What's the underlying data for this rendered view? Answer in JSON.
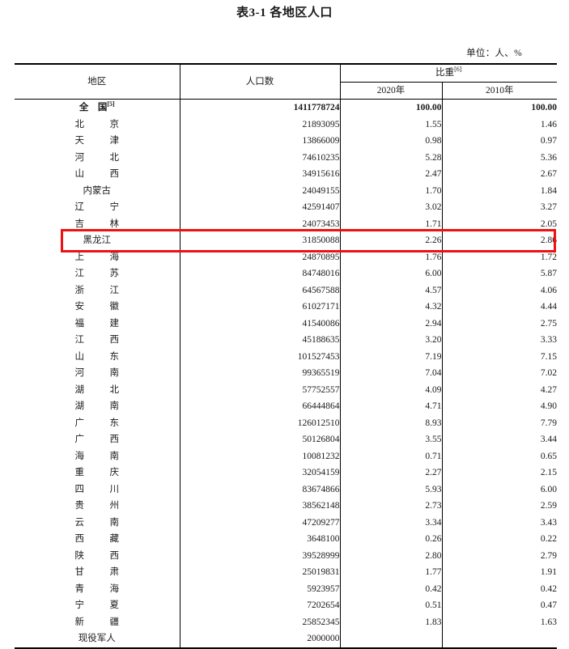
{
  "title": "表3-1 各地区人口",
  "unit_note": "单位：人、%",
  "header": {
    "region": "地区",
    "population": "人口数",
    "share": "比重",
    "share_footnote": "[6]",
    "year_2020": "2020年",
    "year_2010": "2010年"
  },
  "highlight": {
    "region": "黑龙江",
    "color": "#ee1111"
  },
  "rows": [
    {
      "region": "全　国",
      "footnote": "[5]",
      "population": "1411778724",
      "pct2020": "100.00",
      "pct2010": "100.00",
      "bold": true,
      "spaced": false
    },
    {
      "region": "北　京",
      "footnote": "",
      "population": "21893095",
      "pct2020": "1.55",
      "pct2010": "1.46",
      "bold": false,
      "spaced": true
    },
    {
      "region": "天　津",
      "footnote": "",
      "population": "13866009",
      "pct2020": "0.98",
      "pct2010": "0.97",
      "bold": false,
      "spaced": true
    },
    {
      "region": "河　北",
      "footnote": "",
      "population": "74610235",
      "pct2020": "5.28",
      "pct2010": "5.36",
      "bold": false,
      "spaced": true
    },
    {
      "region": "山　西",
      "footnote": "",
      "population": "34915616",
      "pct2020": "2.47",
      "pct2010": "2.67",
      "bold": false,
      "spaced": true
    },
    {
      "region": "内蒙古",
      "footnote": "",
      "population": "24049155",
      "pct2020": "1.70",
      "pct2010": "1.84",
      "bold": false,
      "spaced": false
    },
    {
      "region": "辽　宁",
      "footnote": "",
      "population": "42591407",
      "pct2020": "3.02",
      "pct2010": "3.27",
      "bold": false,
      "spaced": true
    },
    {
      "region": "吉　林",
      "footnote": "",
      "population": "24073453",
      "pct2020": "1.71",
      "pct2010": "2.05",
      "bold": false,
      "spaced": true
    },
    {
      "region": "黑龙江",
      "footnote": "",
      "population": "31850088",
      "pct2020": "2.26",
      "pct2010": "2.86",
      "bold": false,
      "spaced": false
    },
    {
      "region": "上　海",
      "footnote": "",
      "population": "24870895",
      "pct2020": "1.76",
      "pct2010": "1.72",
      "bold": false,
      "spaced": true
    },
    {
      "region": "江　苏",
      "footnote": "",
      "population": "84748016",
      "pct2020": "6.00",
      "pct2010": "5.87",
      "bold": false,
      "spaced": true
    },
    {
      "region": "浙　江",
      "footnote": "",
      "population": "64567588",
      "pct2020": "4.57",
      "pct2010": "4.06",
      "bold": false,
      "spaced": true
    },
    {
      "region": "安　徽",
      "footnote": "",
      "population": "61027171",
      "pct2020": "4.32",
      "pct2010": "4.44",
      "bold": false,
      "spaced": true
    },
    {
      "region": "福　建",
      "footnote": "",
      "population": "41540086",
      "pct2020": "2.94",
      "pct2010": "2.75",
      "bold": false,
      "spaced": true
    },
    {
      "region": "江　西",
      "footnote": "",
      "population": "45188635",
      "pct2020": "3.20",
      "pct2010": "3.33",
      "bold": false,
      "spaced": true
    },
    {
      "region": "山　东",
      "footnote": "",
      "population": "101527453",
      "pct2020": "7.19",
      "pct2010": "7.15",
      "bold": false,
      "spaced": true
    },
    {
      "region": "河　南",
      "footnote": "",
      "population": "99365519",
      "pct2020": "7.04",
      "pct2010": "7.02",
      "bold": false,
      "spaced": true
    },
    {
      "region": "湖　北",
      "footnote": "",
      "population": "57752557",
      "pct2020": "4.09",
      "pct2010": "4.27",
      "bold": false,
      "spaced": true
    },
    {
      "region": "湖　南",
      "footnote": "",
      "population": "66444864",
      "pct2020": "4.71",
      "pct2010": "4.90",
      "bold": false,
      "spaced": true
    },
    {
      "region": "广　东",
      "footnote": "",
      "population": "126012510",
      "pct2020": "8.93",
      "pct2010": "7.79",
      "bold": false,
      "spaced": true
    },
    {
      "region": "广　西",
      "footnote": "",
      "population": "50126804",
      "pct2020": "3.55",
      "pct2010": "3.44",
      "bold": false,
      "spaced": true
    },
    {
      "region": "海　南",
      "footnote": "",
      "population": "10081232",
      "pct2020": "0.71",
      "pct2010": "0.65",
      "bold": false,
      "spaced": true
    },
    {
      "region": "重　庆",
      "footnote": "",
      "population": "32054159",
      "pct2020": "2.27",
      "pct2010": "2.15",
      "bold": false,
      "spaced": true
    },
    {
      "region": "四　川",
      "footnote": "",
      "population": "83674866",
      "pct2020": "5.93",
      "pct2010": "6.00",
      "bold": false,
      "spaced": true
    },
    {
      "region": "贵　州",
      "footnote": "",
      "population": "38562148",
      "pct2020": "2.73",
      "pct2010": "2.59",
      "bold": false,
      "spaced": true
    },
    {
      "region": "云　南",
      "footnote": "",
      "population": "47209277",
      "pct2020": "3.34",
      "pct2010": "3.43",
      "bold": false,
      "spaced": true
    },
    {
      "region": "西　藏",
      "footnote": "",
      "population": "3648100",
      "pct2020": "0.26",
      "pct2010": "0.22",
      "bold": false,
      "spaced": true
    },
    {
      "region": "陕　西",
      "footnote": "",
      "population": "39528999",
      "pct2020": "2.80",
      "pct2010": "2.79",
      "bold": false,
      "spaced": true
    },
    {
      "region": "甘　肃",
      "footnote": "",
      "population": "25019831",
      "pct2020": "1.77",
      "pct2010": "1.91",
      "bold": false,
      "spaced": true
    },
    {
      "region": "青　海",
      "footnote": "",
      "population": "5923957",
      "pct2020": "0.42",
      "pct2010": "0.42",
      "bold": false,
      "spaced": true
    },
    {
      "region": "宁　夏",
      "footnote": "",
      "population": "7202654",
      "pct2020": "0.51",
      "pct2010": "0.47",
      "bold": false,
      "spaced": true
    },
    {
      "region": "新　疆",
      "footnote": "",
      "population": "25852345",
      "pct2020": "1.83",
      "pct2010": "1.63",
      "bold": false,
      "spaced": true
    },
    {
      "region": "现役军人",
      "footnote": "",
      "population": "2000000",
      "pct2020": "",
      "pct2010": "",
      "bold": false,
      "spaced": false
    }
  ]
}
